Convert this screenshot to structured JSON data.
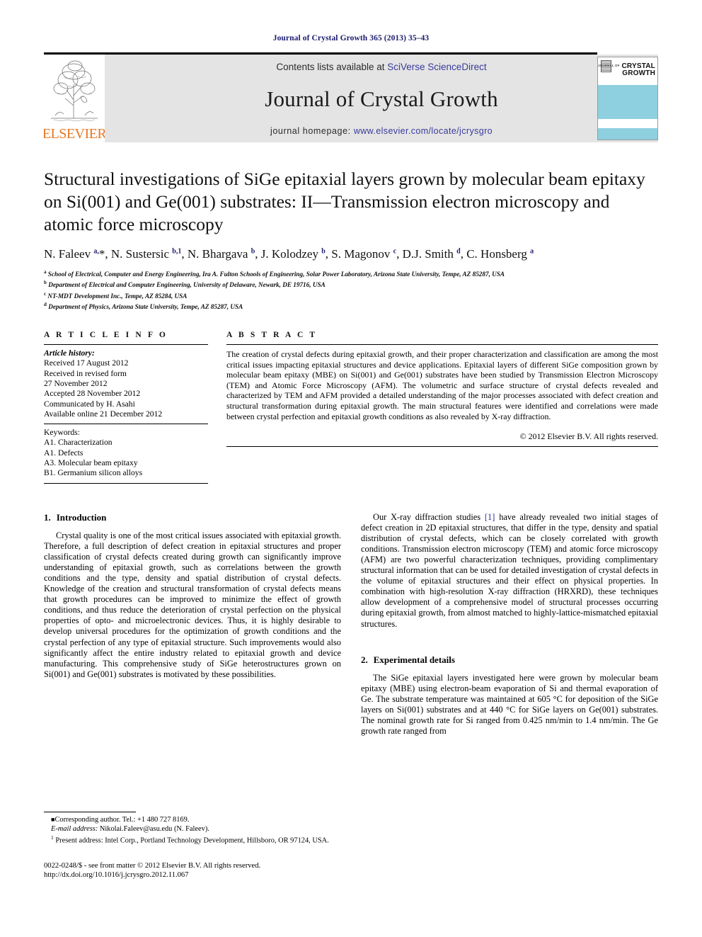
{
  "running_head": "Journal of Crystal Growth 365 (2013) 35–43",
  "masthead": {
    "contents_prefix": "Contents lists available at ",
    "contents_link": "SciVerse ScienceDirect",
    "journal_name": "Journal of Crystal Growth",
    "homepage_prefix": "journal homepage: ",
    "homepage_link": "www.elsevier.com/locate/jcrysgro",
    "publisher_wordmark": "ELSEVIER",
    "cover": {
      "pre_label": "JOURNAL OF",
      "line1": "CRYSTAL",
      "line2": "GROWTH"
    },
    "accent_link_color": "#3a3a9c",
    "elsevier_orange": "#E87722",
    "cover_band_color": "#8ECFE0"
  },
  "article": {
    "title": "Structural investigations of SiGe epitaxial layers grown by molecular beam epitaxy on Si(001) and Ge(001) substrates: II—Transmission electron microscopy and atomic force microscopy",
    "authors_html": "N. Faleev <sup>a,</sup>*, N. Sustersic <sup>b,1</sup>, N. Bhargava <sup>b</sup>, J. Kolodzey <sup>b</sup>, S. Magonov <sup>c</sup>, D.J. Smith <sup>d</sup>, C. Honsberg <sup>a</sup>",
    "affiliations": [
      {
        "marker": "a",
        "text": "School of Electrical, Computer and Energy Engineering, Ira A. Fulton Schools of Engineering, Solar Power Laboratory, Arizona State University, Tempe, AZ 85287, USA"
      },
      {
        "marker": "b",
        "text": "Department of Electrical and Computer Engineering, University of Delaware, Newark, DE 19716, USA"
      },
      {
        "marker": "c",
        "text": "NT-MDT Development Inc., Tempe, AZ 85284, USA"
      },
      {
        "marker": "d",
        "text": "Department of Physics, Arizona State University, Tempe, AZ 85287, USA"
      }
    ]
  },
  "article_info": {
    "heading": "A R T I C L E   I N F O",
    "history_label": "Article history:",
    "history_lines": [
      "Received 17 August 2012",
      "Received in revised form",
      "27 November 2012",
      "Accepted 28 November 2012",
      "Communicated by H. Asahi",
      "Available online 21 December 2012"
    ],
    "keywords_label": "Keywords:",
    "keywords": [
      "A1. Characterization",
      "A1. Defects",
      "A3. Molecular beam epitaxy",
      "B1. Germanium silicon alloys"
    ]
  },
  "abstract": {
    "heading": "A B S T R A C T",
    "text": "The creation of crystal defects during epitaxial growth, and their proper characterization and classification are among the most critical issues impacting epitaxial structures and device applications. Epitaxial layers of different SiGe composition grown by molecular beam epitaxy (MBE) on Si(001) and Ge(001) substrates have been studied by Transmission Electron Microscopy (TEM) and Atomic Force Microscopy (AFM). The volumetric and surface structure of crystal defects revealed and characterized by TEM and AFM provided a detailed understanding of the major processes associated with defect creation and structural transformation during epitaxial growth. The main structural features were identified and correlations were made between crystal perfection and epitaxial growth conditions as also revealed by X-ray diffraction.",
    "copyright": "© 2012 Elsevier B.V. All rights reserved."
  },
  "sections": {
    "intro": {
      "number": "1.",
      "title": "Introduction",
      "paragraph": "Crystal quality is one of the most critical issues associated with epitaxial growth. Therefore, a full description of defect creation in epitaxial structures and proper classification of crystal defects created during growth can significantly improve understanding of epitaxial growth, such as correlations between the growth conditions and the type, density and spatial distribution of crystal defects. Knowledge of the creation and structural transformation of crystal defects means that growth procedures can be improved to minimize the effect of growth conditions, and thus reduce the deterioration of crystal perfection on the physical properties of opto- and microelectronic devices. Thus, it is highly desirable to develop universal procedures for the optimization of growth conditions and the crystal perfection of any type of epitaxial structure. Such improvements would also significantly affect the entire industry related to epitaxial growth and device manufacturing. This comprehensive study of SiGe heterostructures grown on Si(001) and Ge(001) substrates is motivated by these possibilities."
    },
    "intro_right": {
      "paragraph_pre": "Our X-ray diffraction studies ",
      "reference": "[1]",
      "paragraph_post": " have already revealed two initial stages of defect creation in 2D epitaxial structures, that differ in the type, density and spatial distribution of crystal defects, which can be closely correlated with growth conditions. Transmission electron microscopy (TEM) and atomic force microscopy (AFM) are two powerful characterization techniques, providing complimentary structural information that can be used for detailed investigation of crystal defects in the volume of epitaxial structures and their effect on physical properties. In combination with high-resolution X-ray diffraction (HRXRD), these techniques allow development of a comprehensive model of structural processes occurring during epitaxial growth, from almost matched to highly-lattice-mismatched epitaxial structures."
    },
    "experimental": {
      "number": "2.",
      "title": "Experimental details",
      "paragraph": "The SiGe epitaxial layers investigated here were grown by molecular beam epitaxy (MBE) using electron-beam evaporation of Si and thermal evaporation of Ge. The substrate temperature was maintained at 605 °C for deposition of the SiGe layers on Si(001) substrates and at 440 °C for SiGe layers on Ge(001) substrates. The nominal growth rate for Si ranged from 0.425 nm/min to 1.4 nm/min. The Ge growth rate ranged from"
    }
  },
  "footnotes": {
    "corresponding": "Corresponding author. Tel.: +1 480 727 8169.",
    "email_label": "E-mail address:",
    "email_value": "Nikolai.Faleev@asu.edu (N. Faleev).",
    "present_address_marker": "1",
    "present_address": "Present address: Intel Corp., Portland Technology Development, Hillsboro, OR 97124, USA."
  },
  "imprint": {
    "line1": "0022-0248/$ - see front matter © 2012 Elsevier B.V. All rights reserved.",
    "line2": "http://dx.doi.org/10.1016/j.jcrysgro.2012.11.067"
  }
}
